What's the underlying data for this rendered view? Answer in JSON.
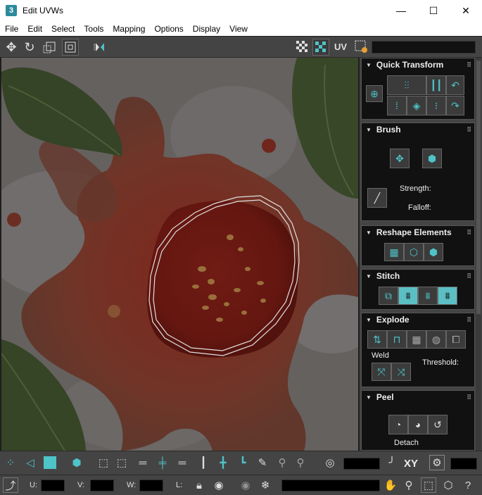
{
  "window": {
    "title": "Edit UVWs",
    "app_icon_text": "3",
    "minimize": "—",
    "maximize": "☐",
    "close": "✕"
  },
  "menu": [
    "File",
    "Edit",
    "Select",
    "Tools",
    "Mapping",
    "Options",
    "Display",
    "View"
  ],
  "toolbar_top": {
    "uv_label": "UV",
    "icons": [
      "move-icon",
      "rotate-icon",
      "scale-icon",
      "freeform-icon",
      "mirror-icon",
      "checker-pattern-icon",
      "checker-texture-icon",
      "uv-settings-icon"
    ]
  },
  "panel": {
    "quick_transform": {
      "title": "Quick Transform"
    },
    "brush": {
      "title": "Brush",
      "strength_label": "Strength:",
      "falloff_label": "Falloff:"
    },
    "reshape": {
      "title": "Reshape Elements"
    },
    "stitch": {
      "title": "Stitch"
    },
    "explode": {
      "title": "Explode",
      "weld_label": "Weld",
      "threshold_label": "Threshold:"
    },
    "peel": {
      "title": "Peel",
      "detach_label": "Detach"
    }
  },
  "toolbar_bottom": {
    "xy_label": "XY",
    "u_label": "U:",
    "v_label": "V:",
    "w_label": "W:",
    "l_label": "L:"
  },
  "colors": {
    "panel_bg": "#444444",
    "rollout_bg": "#111111",
    "accent_cyan": "#4ec3c8",
    "seam_line": "#ffffff"
  }
}
